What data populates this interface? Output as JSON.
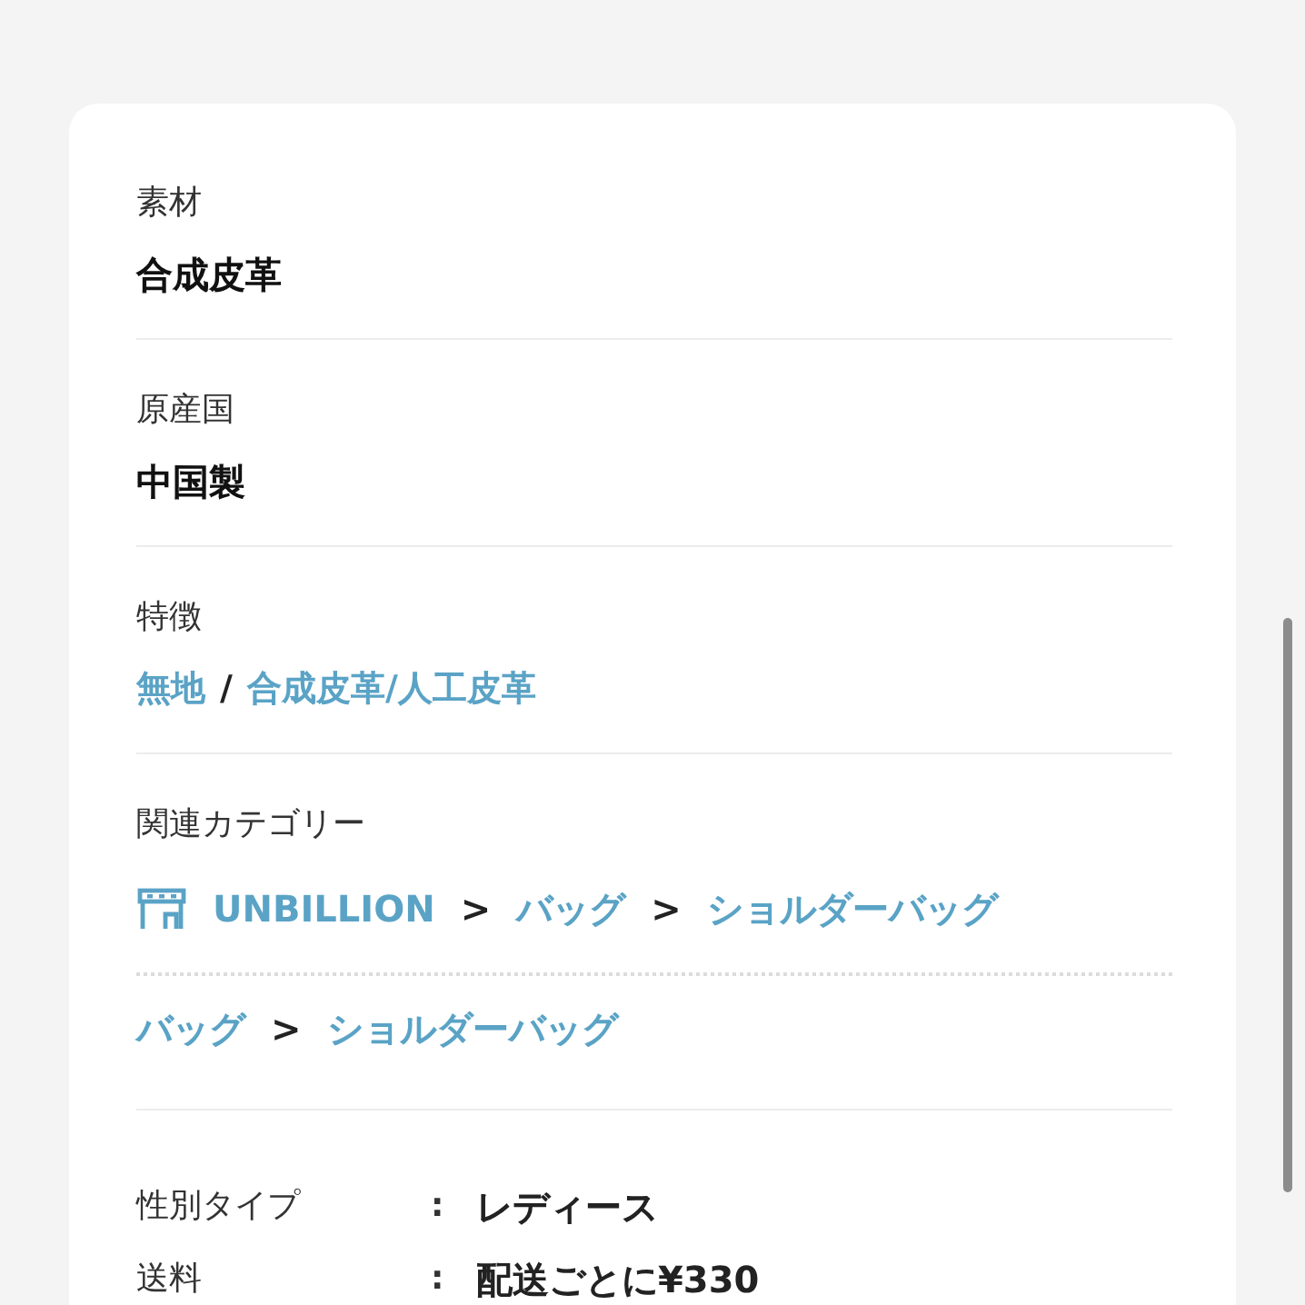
{
  "sections": [
    {
      "kind": "text",
      "label": "素材",
      "value": "合成皮革"
    },
    {
      "kind": "text",
      "label": "原産国",
      "value": "中国製"
    },
    {
      "kind": "links",
      "label": "特徴",
      "items": [
        {
          "kind": "link",
          "text": "無地"
        },
        {
          "kind": "separator",
          "text": "/"
        },
        {
          "kind": "link",
          "text": "合成皮革/人工皮革"
        }
      ]
    },
    {
      "kind": "categories",
      "label": "関連カテゴリー",
      "paths": [
        {
          "items": [
            {
              "kind": "shop",
              "text": "UNBILLION"
            },
            {
              "kind": "separator",
              "text": ">"
            },
            {
              "kind": "link",
              "text": "バッグ"
            },
            {
              "kind": "separator",
              "text": ">"
            },
            {
              "kind": "link",
              "text": "ショルダーバッグ"
            }
          ]
        },
        {
          "items": [
            {
              "kind": "link",
              "text": "バッグ"
            },
            {
              "kind": "separator",
              "text": ">"
            },
            {
              "kind": "link",
              "text": "ショルダーバッグ"
            }
          ]
        }
      ]
    }
  ],
  "details": [
    {
      "label": "性別タイプ",
      "separator": ":",
      "value": "レディース"
    },
    {
      "label": "送料",
      "separator": ":",
      "value": "配送ごとに¥330"
    }
  ]
}
